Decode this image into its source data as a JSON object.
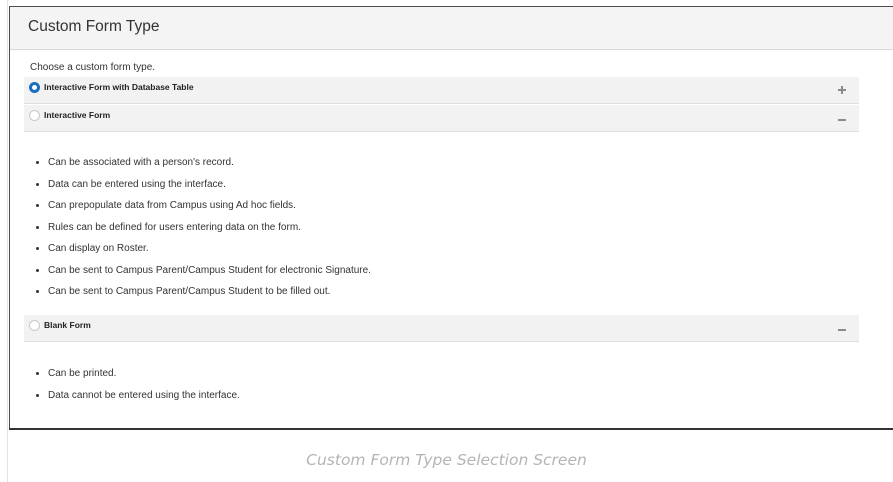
{
  "panel": {
    "title": "Custom Form Type",
    "prompt": "Choose a custom form type."
  },
  "options": [
    {
      "label": "Interactive Form with Database Table",
      "selected": true,
      "expanded": false,
      "toggle_icon": "plus-icon",
      "features": []
    },
    {
      "label": "Interactive Form",
      "selected": false,
      "expanded": true,
      "toggle_icon": "minus-icon",
      "features": [
        "Can be associated with a person's record.",
        "Data can be entered using the interface.",
        "Can prepopulate data from Campus using Ad hoc fields.",
        "Rules can be defined for users entering data on the form.",
        "Can display on Roster.",
        "Can be sent to Campus Parent/Campus Student for electronic Signature.",
        "Can be sent to Campus Parent/Campus Student to be filled out."
      ]
    },
    {
      "label": "Blank Form",
      "selected": false,
      "expanded": true,
      "toggle_icon": "minus-icon",
      "features": [
        "Can be printed.",
        "Data cannot be entered using the interface."
      ]
    }
  ],
  "caption": "Custom Form Type Selection Screen",
  "colors": {
    "selected_radio": "#1a6cc4",
    "header_bg": "#f4f4f4",
    "row_bg": "#f2f2f2",
    "caption": "#b4b4b4"
  }
}
